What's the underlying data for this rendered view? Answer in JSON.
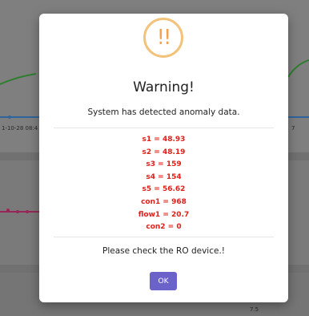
{
  "background": {
    "tick_left": "1-10-28 08:4",
    "tick_right": "7",
    "tick_bottom": "7.5"
  },
  "dialog": {
    "icon": "warning-exclamation-icon",
    "icon_glyph": "!!",
    "title": "Warning!",
    "message": "System has detected anomaly data.",
    "values": [
      "s1 = 48.93",
      "s2 = 48.19",
      "s3 = 159",
      "s4 = 154",
      "s5 = 56.62",
      "con1 = 968",
      "flow1 = 20.7",
      "con2 = 0"
    ],
    "footer": "Please check the RO device.!",
    "ok_label": "OK"
  },
  "colors": {
    "accent": "#6b63c9",
    "warning": "#f0a350",
    "values": "#e0201a"
  }
}
